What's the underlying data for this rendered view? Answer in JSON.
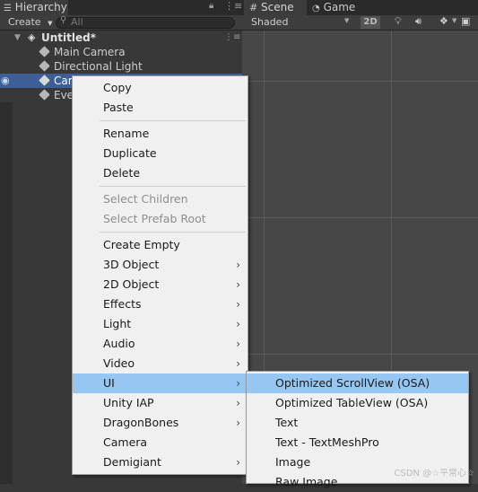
{
  "hierarchy": {
    "tab_label": "Hierarchy",
    "create_label": "Create",
    "search_placeholder": "All",
    "scene_name": "Untitled*",
    "items": [
      {
        "label": "Main Camera"
      },
      {
        "label": "Directional Light"
      },
      {
        "label": "Can"
      },
      {
        "label": "Eve"
      }
    ]
  },
  "scene": {
    "tabs": [
      {
        "label": "Scene"
      },
      {
        "label": "Game"
      }
    ],
    "shading_mode": "Shaded",
    "toggle_2d": "2D"
  },
  "context_menu": {
    "items": [
      {
        "label": "Copy"
      },
      {
        "label": "Paste"
      },
      {
        "label": "Rename"
      },
      {
        "label": "Duplicate"
      },
      {
        "label": "Delete"
      },
      {
        "label": "Select Children"
      },
      {
        "label": "Select Prefab Root"
      },
      {
        "label": "Create Empty"
      },
      {
        "label": "3D Object"
      },
      {
        "label": "2D Object"
      },
      {
        "label": "Effects"
      },
      {
        "label": "Light"
      },
      {
        "label": "Audio"
      },
      {
        "label": "Video"
      },
      {
        "label": "UI"
      },
      {
        "label": "Unity IAP"
      },
      {
        "label": "DragonBones"
      },
      {
        "label": "Camera"
      },
      {
        "label": "Demigiant"
      }
    ]
  },
  "submenu": {
    "items": [
      {
        "label": "Optimized ScrollView (OSA)"
      },
      {
        "label": "Optimized TableView (OSA)"
      },
      {
        "label": "Text"
      },
      {
        "label": "Text - TextMeshPro"
      },
      {
        "label": "Image"
      },
      {
        "label": "Raw Image"
      }
    ]
  },
  "watermark": "CSDN @☆平常心☆",
  "colors": {
    "selection": "#3e5f96",
    "menu_highlight": "#96c6f2",
    "menu_bg": "#f0f0f0",
    "panel_bg": "#383838"
  }
}
